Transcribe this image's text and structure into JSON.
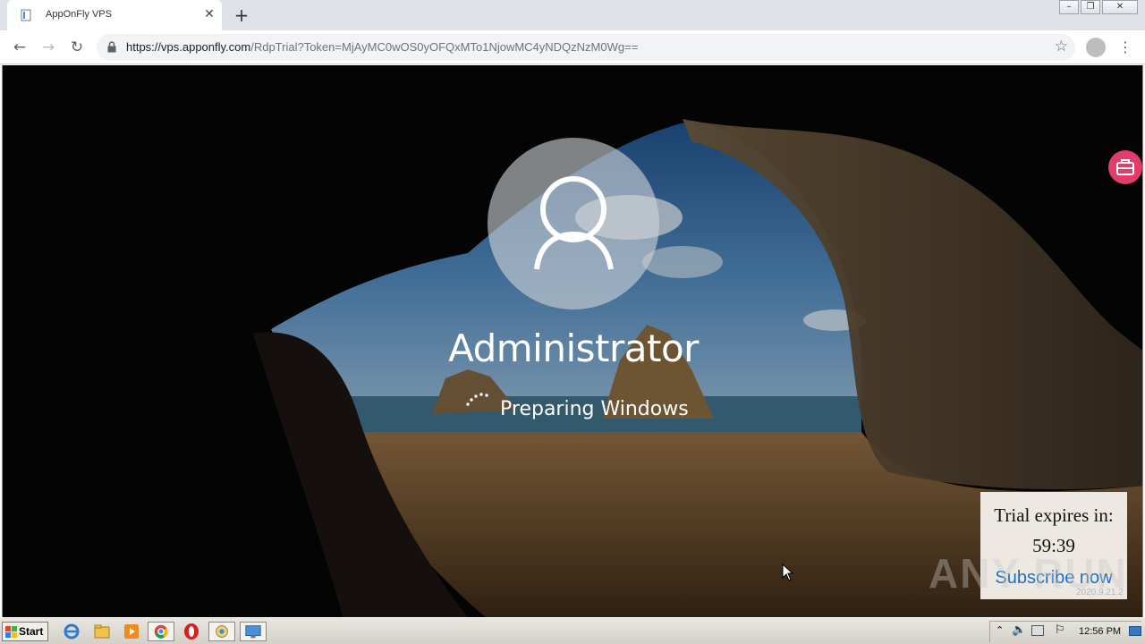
{
  "browser": {
    "tab_title": "AppOnFly VPS",
    "url_host": "https://vps.apponfly.com",
    "url_rest": "/RdpTrial?Token=MjAyMC0wOS0yOFQxMTo1NjowMC4yNDQzNzM0Wg=="
  },
  "login": {
    "username": "Administrator",
    "status": "Preparing Windows"
  },
  "trial": {
    "label": "Trial expires in:",
    "time": "59:39",
    "cta": "Subscribe now"
  },
  "overlay": {
    "watermark": "ANY RUN",
    "version": "2020.9.21.2"
  },
  "taskbar": {
    "start_label": "Start",
    "clock": "12:56 PM"
  },
  "icons": [
    "page-icon",
    "close-icon",
    "plus-icon",
    "back-icon",
    "forward-icon",
    "reload-icon",
    "lock-icon",
    "star-icon",
    "profile-icon",
    "menu-icon",
    "user-avatar-icon",
    "spinner-icon",
    "toolkit-icon",
    "cursor-icon",
    "windows-flag-icon",
    "ie-icon",
    "folder-icon",
    "media-player-icon",
    "chrome-icon",
    "opera-icon",
    "app-icon",
    "remote-desktop-icon"
  ]
}
